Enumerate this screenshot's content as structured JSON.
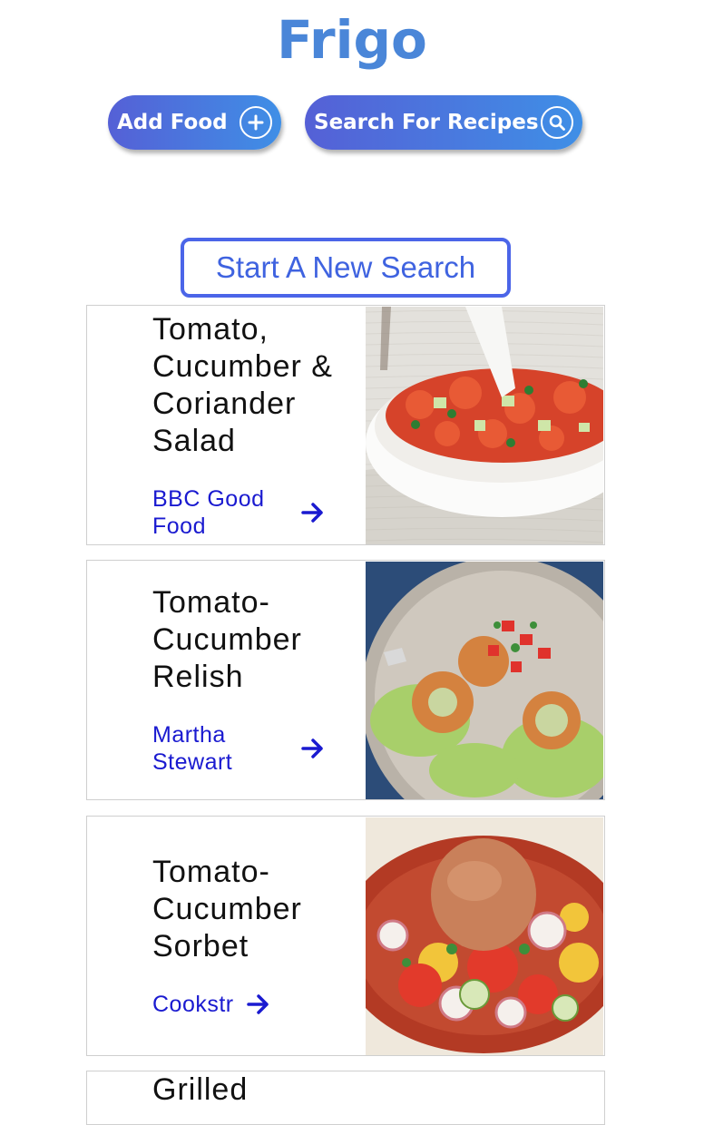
{
  "app": {
    "title": "Frigo"
  },
  "toolbar": {
    "add_food_label": "Add Food",
    "search_recipes_label": "Search For Recipes"
  },
  "new_search_label": "Start A New Search",
  "recipes": [
    {
      "name": "Tomato, Cucumber & Coriander Salad",
      "source": "BBC Good Food"
    },
    {
      "name": "Tomato-Cucumber Relish",
      "source": "Martha Stewart"
    },
    {
      "name": "Tomato-Cucumber Sorbet",
      "source": "Cookstr"
    },
    {
      "name": "Grilled"
    }
  ],
  "colors": {
    "accent": "#4a86d8",
    "gradient_start": "#5560d6",
    "gradient_end": "#3f8fe6",
    "link": "#1a1ad0",
    "outline": "#4b65e8"
  },
  "icons": [
    "plus-circle-icon",
    "search-icon",
    "arrow-right-icon"
  ]
}
